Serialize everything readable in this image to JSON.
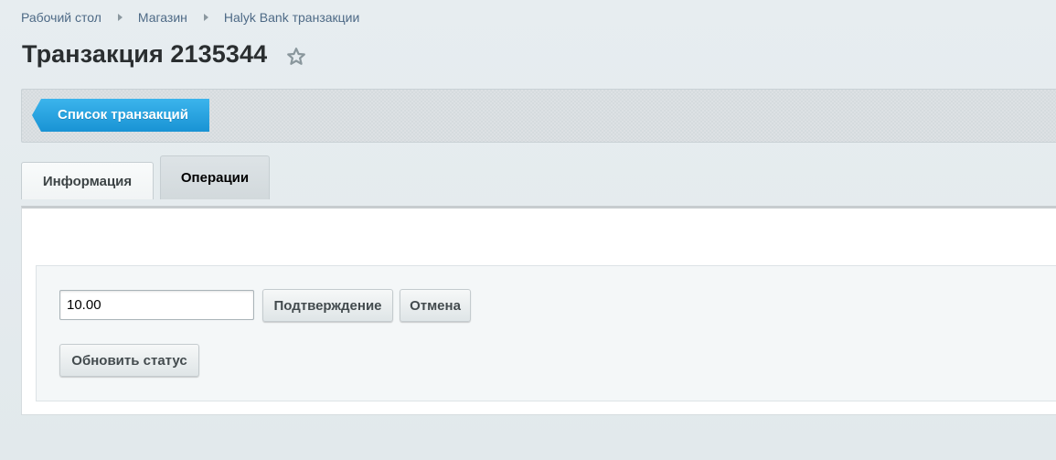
{
  "breadcrumb": {
    "items": [
      "Рабочий стол",
      "Магазин",
      "Halyk Bank транзакции"
    ]
  },
  "header": {
    "title": "Транзакция 2135344",
    "favorite_icon": "star-outline-icon"
  },
  "toolbar": {
    "back_label": "Список транзакций"
  },
  "tabs": [
    {
      "label": "Информация",
      "active": false
    },
    {
      "label": "Операции",
      "active": true
    }
  ],
  "operations": {
    "amount_value": "10.00",
    "confirm_label": "Подтверждение",
    "cancel_label": "Отмена",
    "refresh_label": "Обновить статус"
  },
  "colors": {
    "accent": "#1e9ad9",
    "link": "#4e6a86"
  }
}
